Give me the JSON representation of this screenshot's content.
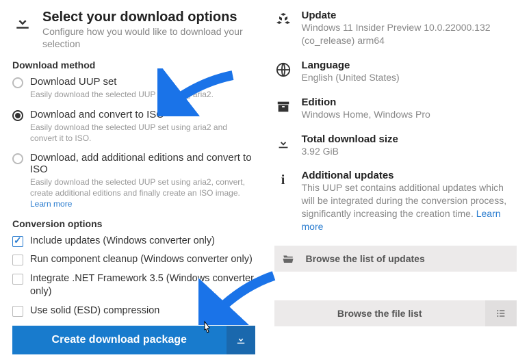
{
  "header": {
    "title": "Select your download options",
    "subtitle": "Configure how you would like to download your selection"
  },
  "download_method": {
    "section_title": "Download method",
    "options": [
      {
        "title": "Download UUP set",
        "desc": "Easily download the selected UUP set using aria2."
      },
      {
        "title": "Download and convert to ISO",
        "desc": "Easily download the selected UUP set using aria2 and convert it to ISO."
      },
      {
        "title": "Download, add additional editions and convert to ISO",
        "desc": "Easily download the selected UUP set using aria2, convert, create additional editions and finally create an ISO image. ",
        "learn_more": "Learn more"
      }
    ]
  },
  "conversion": {
    "section_title": "Conversion options",
    "options": [
      {
        "label": "Include updates (Windows converter only)"
      },
      {
        "label": "Run component cleanup (Windows converter only)"
      },
      {
        "label": "Integrate .NET Framework 3.5 (Windows converter only)"
      },
      {
        "label": "Use solid (ESD) compression"
      }
    ]
  },
  "create_btn": "Create download package",
  "info": {
    "update": {
      "title": "Update",
      "value": "Windows 11 Insider Preview 10.0.22000.132 (co_release) arm64"
    },
    "language": {
      "title": "Language",
      "value": "English (United States)"
    },
    "edition": {
      "title": "Edition",
      "value": "Windows Home, Windows Pro"
    },
    "size": {
      "title": "Total download size",
      "value": "3.92 GiB"
    },
    "additional": {
      "title": "Additional updates",
      "desc": "This UUP set contains additional updates which will be integrated during the conversion process, significantly increasing the creation time. ",
      "learn_more": "Learn more"
    }
  },
  "browse_updates": "Browse the list of updates",
  "browse_files": "Browse the file list"
}
